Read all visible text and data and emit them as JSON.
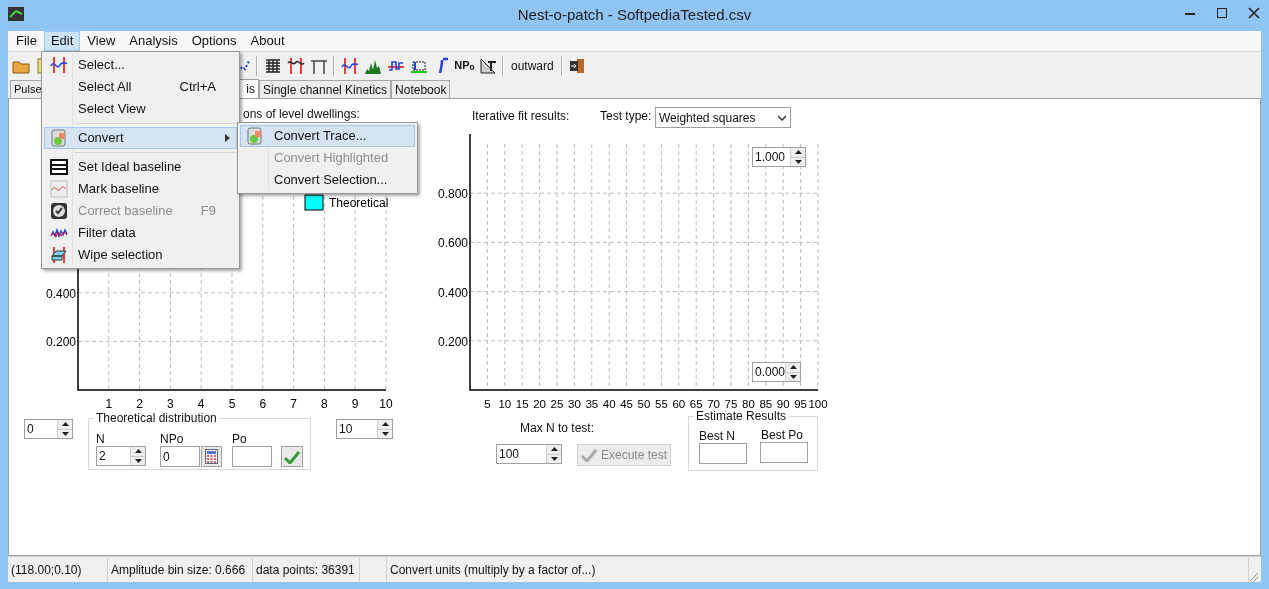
{
  "window": {
    "title": "Nest-o-patch - SoftpediaTested.csv"
  },
  "menu_bar": [
    {
      "label": "File",
      "selected": false
    },
    {
      "label": "Edit",
      "selected": true
    },
    {
      "label": "View",
      "selected": false
    },
    {
      "label": "Analysis",
      "selected": false
    },
    {
      "label": "Options",
      "selected": false
    },
    {
      "label": "About",
      "selected": false
    }
  ],
  "toolbar": {
    "npo_button": "NP$_{o}$",
    "mode_button": "outward"
  },
  "tabs": [
    {
      "label": "Pulse",
      "selected": false
    },
    {
      "label": "is",
      "selected": true
    },
    {
      "label": "Single channel Kinetics",
      "selected": false
    },
    {
      "label": "Notebook",
      "selected": false
    }
  ],
  "amplitude_panel": {
    "caption": "ons of level dwellings:",
    "chart_data": {
      "type": "line",
      "grid": true,
      "xlim": [
        0,
        10
      ],
      "ylim": [
        0,
        1
      ],
      "xticks": [
        1,
        2,
        3,
        4,
        5,
        6,
        7,
        8,
        9,
        10
      ],
      "yticks": [
        {
          "value": 0.2,
          "label": "0.200"
        },
        {
          "value": 0.4,
          "label": "0.400"
        }
      ]
    },
    "legend": [
      {
        "label": "Theoretical",
        "color": "#00ffff"
      }
    ],
    "min_value": "0",
    "max_value": "10",
    "theoretical_distribution": {
      "title": "Theoretical distribution",
      "n_label": "N",
      "n_value": "2",
      "npo_label": "NPo",
      "npo_value": "0",
      "po_label": "Po"
    }
  },
  "fit_panel": {
    "caption": "Iterative fit results:",
    "test_type_label": "Test type:",
    "test_type": "Weighted squares",
    "chart_data": {
      "type": "line",
      "grid": true,
      "xlim": [
        0,
        100
      ],
      "ylim": [
        0,
        1
      ],
      "xticks": [
        5,
        10,
        15,
        20,
        25,
        30,
        35,
        40,
        45,
        50,
        55,
        60,
        65,
        70,
        75,
        80,
        85,
        90,
        95,
        100
      ],
      "yticks": [
        {
          "value": 0.2,
          "label": "0.200"
        },
        {
          "value": 0.4,
          "label": "0.400"
        },
        {
          "value": 0.6,
          "label": "0.600"
        },
        {
          "value": 0.8,
          "label": "0.800"
        }
      ]
    },
    "y_max": "1.000",
    "y_min": "0.000",
    "max_n_label": "Max N to test:",
    "max_n": "100",
    "execute_button": {
      "label": "Execute test",
      "disabled": true
    },
    "estimate_results": {
      "title": "Estimate Results",
      "best_n_label": "Best N",
      "best_po_label": "Best Po"
    }
  },
  "status_bar": [
    "(118.00;0.10)",
    "Amplitude bin size: 0.666",
    "data points: 36391",
    "Convert units (multiply by a factor of...)"
  ],
  "edit_menu": {
    "items": [
      {
        "kind": "item",
        "label": "Select...",
        "disabled": false,
        "selected": false
      },
      {
        "kind": "item",
        "label": "Select All",
        "shortcut": "Ctrl+A",
        "disabled": false,
        "selected": false
      },
      {
        "kind": "item",
        "label": "Select View",
        "disabled": false,
        "selected": false
      },
      {
        "kind": "separator"
      },
      {
        "kind": "item",
        "label": "Convert",
        "submenu": true,
        "disabled": false,
        "selected": true
      },
      {
        "kind": "separator"
      },
      {
        "kind": "item",
        "label": "Set Ideal baseline",
        "disabled": false,
        "selected": false
      },
      {
        "kind": "item",
        "label": "Mark baseline",
        "disabled": false,
        "selected": false
      },
      {
        "kind": "item",
        "label": "Correct baseline",
        "shortcut": "F9",
        "disabled": true,
        "selected": false
      },
      {
        "kind": "item",
        "label": "Filter data",
        "disabled": false,
        "selected": false
      },
      {
        "kind": "item",
        "label": "Wipe selection",
        "disabled": false,
        "selected": false
      }
    ]
  },
  "convert_submenu": {
    "items": [
      {
        "kind": "item",
        "label": "Convert Trace...",
        "disabled": false,
        "selected": true
      },
      {
        "kind": "item",
        "label": "Convert Highlighted",
        "disabled": true,
        "selected": false
      },
      {
        "kind": "item",
        "label": "Convert Selection...",
        "disabled": false,
        "selected": false
      }
    ]
  }
}
